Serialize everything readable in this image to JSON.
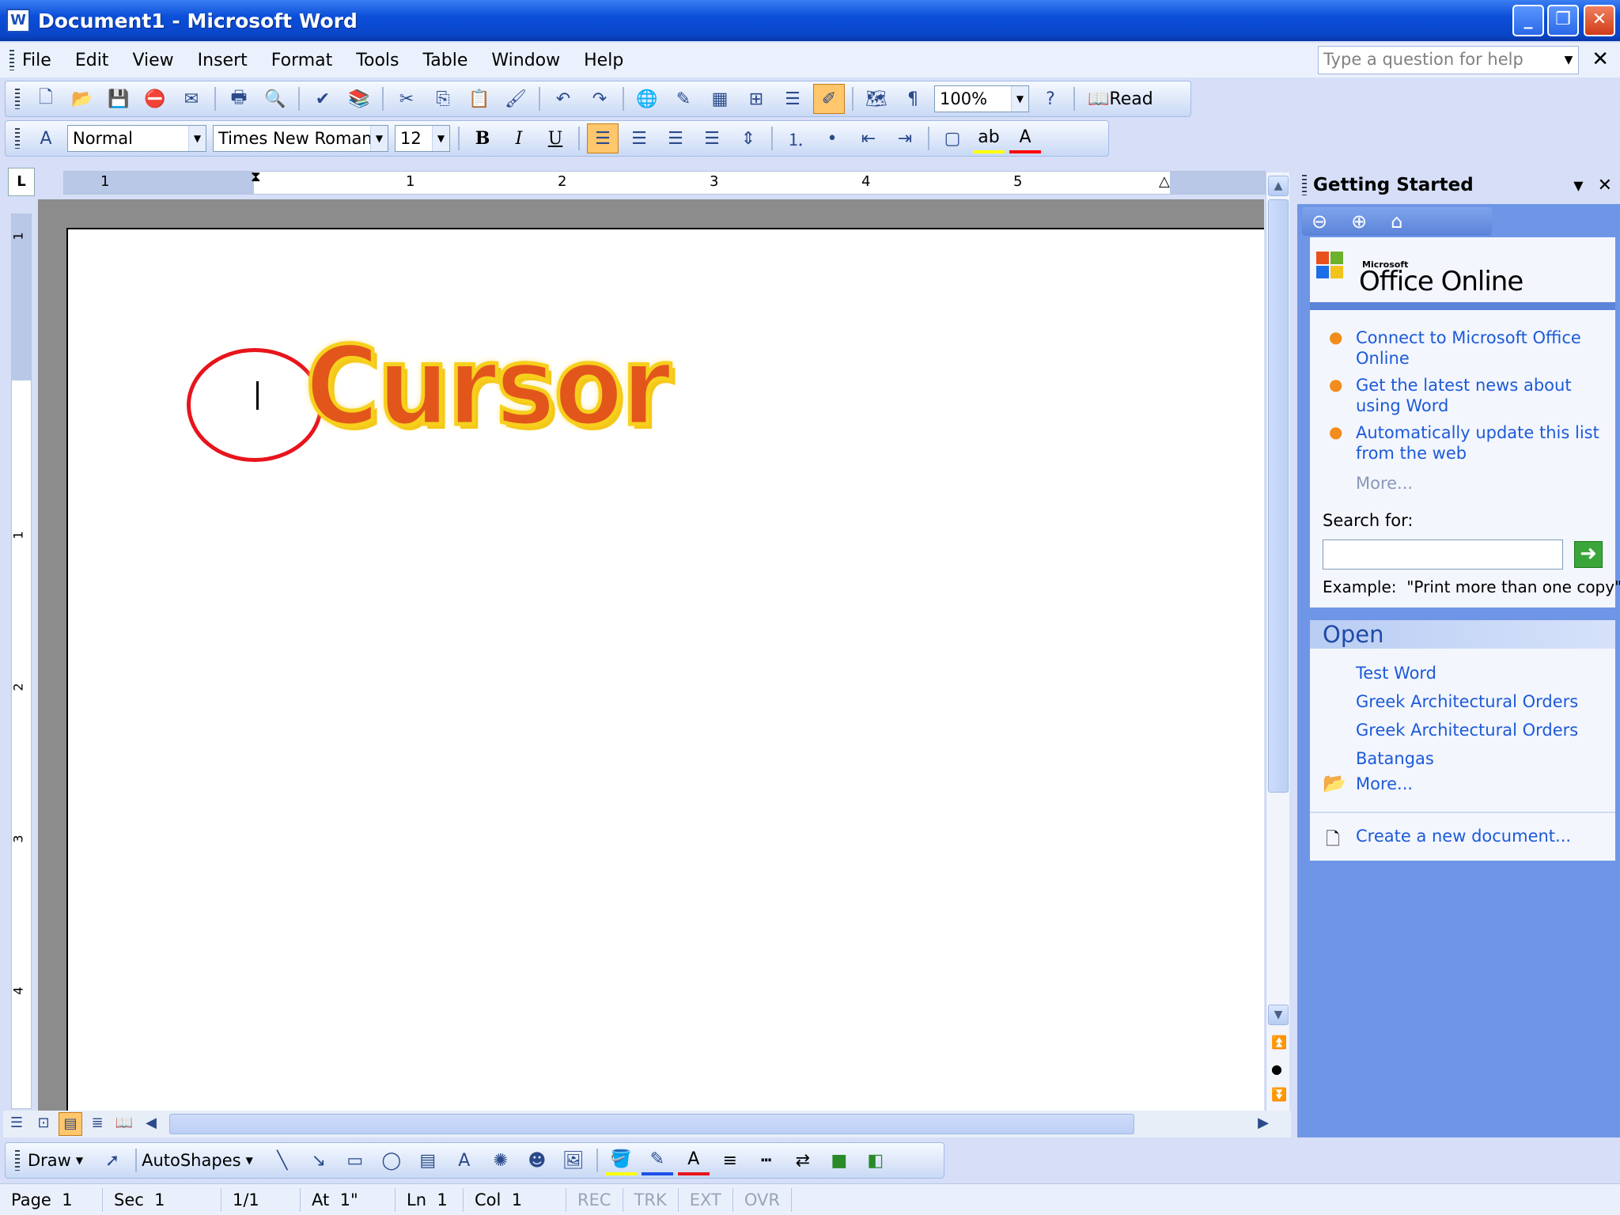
{
  "window": {
    "title": "Document1 - Microsoft Word"
  },
  "menu": [
    "File",
    "Edit",
    "View",
    "Insert",
    "Format",
    "Tools",
    "Table",
    "Window",
    "Help"
  ],
  "help_box": {
    "placeholder": "Type a question for help"
  },
  "standard_toolbar": {
    "zoom": "100%",
    "read_label": "Read"
  },
  "formatting_toolbar": {
    "style": "Normal",
    "font": "Times New Roman",
    "size": "12",
    "align_left_active": true
  },
  "ruler": {
    "h_numbers": [
      "1",
      "1",
      "2",
      "3",
      "4",
      "5"
    ],
    "v_numbers": [
      "1",
      "1",
      "2",
      "3",
      "4"
    ]
  },
  "document": {
    "wordart_text": "Cursor",
    "annotation": "red circle around text cursor"
  },
  "task_pane": {
    "title": "Getting Started",
    "office_logo_small": "Microsoft",
    "office_logo": "Office Online",
    "links": [
      "Connect to Microsoft Office Online",
      "Get the latest news about using Word",
      "Automatically update this list from the web"
    ],
    "more1": "More...",
    "search_label": "Search for:",
    "search_example": "Example:  \"Print more than one copy\"",
    "open_title": "Open",
    "open_files": [
      "Test Word",
      "Greek Architectural Orders",
      "Greek Architectural Orders",
      "Batangas"
    ],
    "more2": "More...",
    "create_new": "Create a new document..."
  },
  "draw_toolbar": {
    "draw_label": "Draw",
    "autoshapes_label": "AutoShapes"
  },
  "status_bar": {
    "page": "Page  1",
    "sec": "Sec  1",
    "pages": "1/1",
    "at": "At  1\"",
    "ln": "Ln  1",
    "col": "Col  1",
    "rec": "REC",
    "trk": "TRK",
    "ext": "EXT",
    "ovr": "OVR"
  }
}
